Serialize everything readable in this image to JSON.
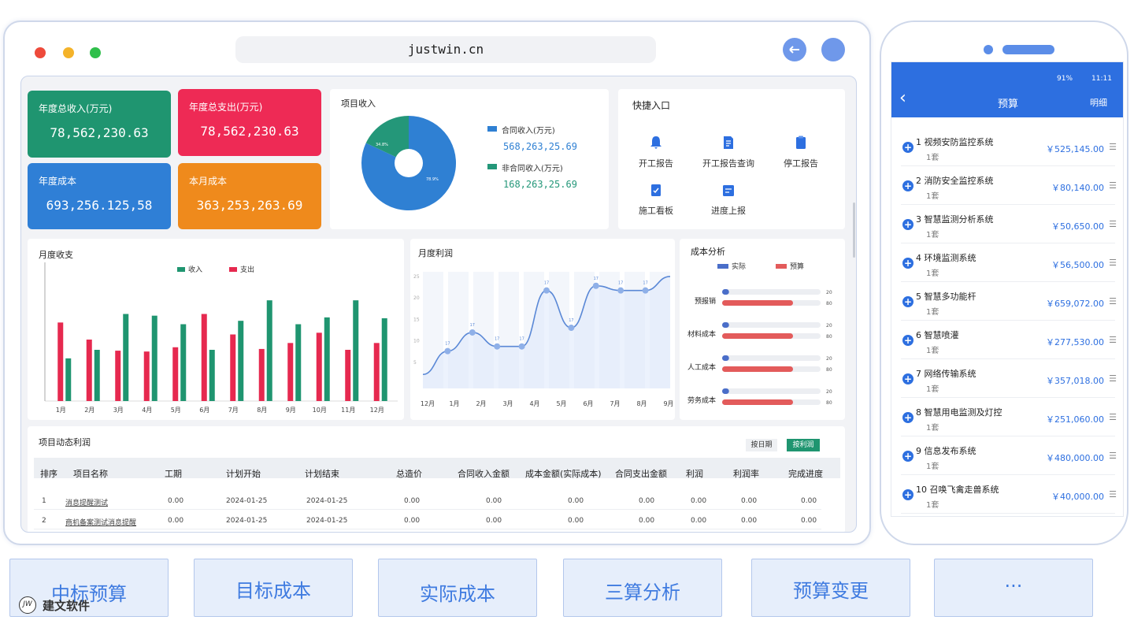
{
  "browser": {
    "url": "justwin.cn"
  },
  "stats": [
    {
      "label": "年度总收入(万元)",
      "value": "78,562,230.63",
      "color": "#1f9570"
    },
    {
      "label": "年度总支出(万元)",
      "value": "78,562,230.63",
      "color": "#ee2a55"
    },
    {
      "label": "年度成本",
      "value": "693,256.125,58",
      "color": "#2f7fd6"
    },
    {
      "label": "本月成本",
      "value": "363,253,263.69",
      "color": "#ef8a1c"
    }
  ],
  "project_income": {
    "title": "项目收入",
    "legend": [
      {
        "name": "合同收入(万元)",
        "value": "568,263,25.69",
        "color": "#2f80d3"
      },
      {
        "name": "非合同收入(万元)",
        "value": "168,263,25.69",
        "color": "#249779"
      }
    ],
    "pie_labels": [
      "34.8%",
      "78.9%"
    ]
  },
  "quick": {
    "title": "快捷入口",
    "items": [
      {
        "label": "开工报告",
        "icon": "bell-icon"
      },
      {
        "label": "开工报告查询",
        "icon": "document-icon"
      },
      {
        "label": "停工报告",
        "icon": "clipboard-icon"
      },
      {
        "label": "施工看板",
        "icon": "clipboard-check-icon"
      },
      {
        "label": "进度上报",
        "icon": "calendar-icon"
      }
    ]
  },
  "chart_data": [
    {
      "type": "bar",
      "title": "月度收支",
      "categories": [
        "1月",
        "2月",
        "3月",
        "4月",
        "5月",
        "6月",
        "7月",
        "8月",
        "9月",
        "10月",
        "11月",
        "12月"
      ],
      "series": [
        {
          "name": "收入",
          "color": "#1f9570",
          "values": [
            50,
            60,
            102,
            100,
            90,
            60,
            94,
            118,
            90,
            98,
            118,
            97
          ]
        },
        {
          "name": "支出",
          "color": "#e6294f",
          "values": [
            92,
            72,
            59,
            58,
            63,
            102,
            78,
            61,
            68,
            80,
            60,
            68
          ]
        }
      ]
    },
    {
      "type": "line",
      "title": "月度利润",
      "categories": [
        "12月",
        "1月",
        "2月",
        "3月",
        "4月",
        "5月",
        "6月",
        "7月",
        "8月",
        "9月"
      ],
      "y_ticks": [
        "25",
        "20",
        "15",
        "10",
        "5"
      ],
      "values": [
        3,
        8,
        12,
        9,
        9,
        21,
        13,
        22,
        21,
        21,
        24
      ],
      "point_label": "17"
    },
    {
      "type": "bar",
      "title": "成本分析",
      "legend": [
        {
          "name": "实际",
          "color": "#4a6ec9"
        },
        {
          "name": "预算",
          "color": "#e35b5b"
        }
      ],
      "categories": [
        "预报销",
        "材料成本",
        "人工成本",
        "劳务成本"
      ],
      "series": [
        {
          "name": "实际",
          "values": [
            20,
            20,
            20,
            20
          ]
        },
        {
          "name": "预算",
          "values": [
            80,
            80,
            80,
            80
          ]
        }
      ],
      "tick_actual": "20",
      "tick_budget": "80"
    }
  ],
  "table": {
    "title": "项目动态利润",
    "btn_date": "按日期",
    "btn_profit": "按利润",
    "headers": [
      "排序",
      "项目名称",
      "工期",
      "计划开始",
      "计划结束",
      "总造价",
      "合同收入金额",
      "成本金额(实际成本)",
      "合同支出金额",
      "利润",
      "利润率",
      "完成进度"
    ],
    "rows": [
      [
        "1",
        "消息提醒测试",
        "0.00",
        "2024-01-25",
        "2024-01-25",
        "0.00",
        "0.00",
        "0.00",
        "0.00",
        "0.00",
        "0.00",
        "0.00"
      ],
      [
        "2",
        "商机备案测试消息提醒",
        "0.00",
        "2024-01-25",
        "2024-01-25",
        "0.00",
        "0.00",
        "0.00",
        "0.00",
        "0.00",
        "0.00",
        "0.00"
      ]
    ]
  },
  "phone": {
    "status_time": "11:11",
    "status_battery": "91%",
    "title": "预算",
    "detail": "明细",
    "back": "‹",
    "items": [
      {
        "name": "1 视频安防监控系统",
        "qty": "1套",
        "amount": "￥525,145.00"
      },
      {
        "name": "2 消防安全监控系统",
        "qty": "1套",
        "amount": "￥80,140.00"
      },
      {
        "name": "3 智慧监测分析系统",
        "qty": "1套",
        "amount": "￥50,650.00"
      },
      {
        "name": "4 环境监测系统",
        "qty": "1套",
        "amount": "￥56,500.00"
      },
      {
        "name": "5 智慧多功能杆",
        "qty": "1套",
        "amount": "￥659,072.00"
      },
      {
        "name": "6 智慧喷灌",
        "qty": "1套",
        "amount": "￥277,530.00"
      },
      {
        "name": "7 网络传输系统",
        "qty": "1套",
        "amount": "￥357,018.00"
      },
      {
        "name": "8 智慧用电监测及灯控",
        "qty": "1套",
        "amount": "￥251,060.00"
      },
      {
        "name": "9 信息发布系统",
        "qty": "1套",
        "amount": "￥480,000.00"
      },
      {
        "name": "10 召唤飞禽走兽系统",
        "qty": "1套",
        "amount": "￥40,000.00"
      }
    ]
  },
  "tabs": [
    "中标预算",
    "目标成本",
    "实际成本",
    "三算分析",
    "预算变更",
    "···"
  ],
  "brand": {
    "logo": "JW",
    "name": "建文软件"
  }
}
